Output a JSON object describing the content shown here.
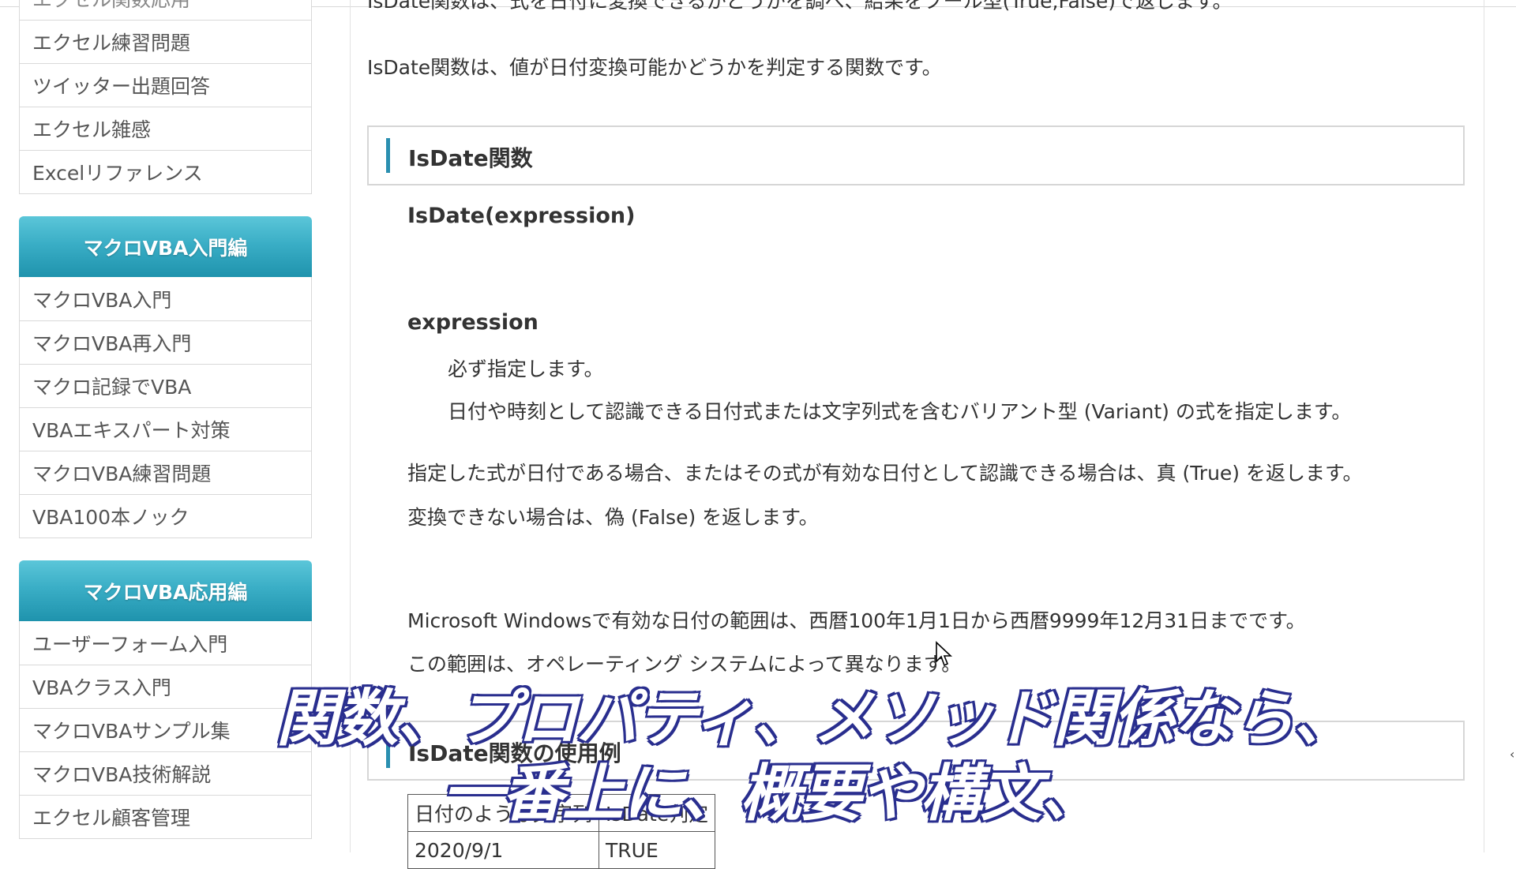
{
  "sidebar": {
    "top_items": [
      {
        "label": "エクセル関数応用"
      },
      {
        "label": "エクセル練習問題"
      },
      {
        "label": "ツイッター出題回答"
      },
      {
        "label": "エクセル雑感"
      },
      {
        "label": "Excelリファレンス"
      }
    ],
    "sections": [
      {
        "title": "マクロVBA入門編",
        "items": [
          {
            "label": "マクロVBA入門"
          },
          {
            "label": "マクロVBA再入門"
          },
          {
            "label": "マクロ記録でVBA"
          },
          {
            "label": "VBAエキスパート対策"
          },
          {
            "label": "マクロVBA練習問題"
          },
          {
            "label": "VBA100本ノック"
          }
        ]
      },
      {
        "title": "マクロVBA応用編",
        "items": [
          {
            "label": "ユーザーフォーム入門"
          },
          {
            "label": "VBAクラス入門"
          },
          {
            "label": "マクロVBAサンプル集"
          },
          {
            "label": "マクロVBA技術解説"
          },
          {
            "label": "エクセル顧客管理"
          }
        ]
      }
    ]
  },
  "main": {
    "cut_line": "IsDate関数は、式を日付に変換できるかどうかを調べ、結果をブール型(True,False)で返します。",
    "intro": "IsDate関数は、値が日付変換可能かどうかを判定する関数です。",
    "heading1": "IsDate関数",
    "syntax": "IsDate(expression)",
    "param_name": "expression",
    "param_required": "必ず指定します。",
    "param_desc": "日付や時刻として認識できる日付式または文字列式を含むバリアント型 (Variant) の式を指定します。",
    "return_true": "指定した式が日付である場合、またはその式が有効な日付として認識できる場合は、真 (True) を返します。",
    "return_false": "変換できない場合は、偽 (False) を返します。",
    "range_note": "Microsoft Windowsで有効な日付の範囲は、西暦100年1月1日から西暦9999年12月31日までです。",
    "range_os": "この範囲は、オペレーティング システムによって異なります。",
    "heading2": "IsDate関数の使用例",
    "table": {
      "headers": [
        "日付のような文字列",
        "IsDate判定"
      ],
      "rows": [
        [
          "2020/9/1",
          "TRUE"
        ]
      ]
    }
  },
  "caption": {
    "line1": "関数、プロパティ、メソッド関係なら、",
    "line2": "一番上に、概要や構文、"
  },
  "colors": {
    "section_header": "#3aaec6",
    "heading_bar": "#2a8fb0",
    "caption_outline": "#2a2f8f"
  }
}
